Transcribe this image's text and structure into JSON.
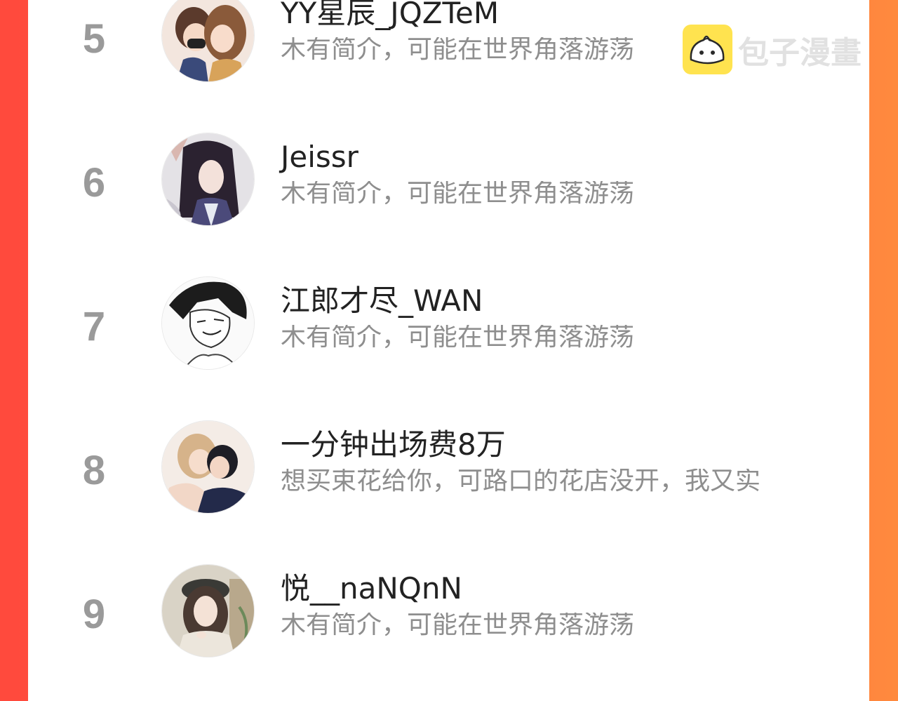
{
  "ranking": {
    "rows": [
      {
        "rank": "5",
        "name": "YY星辰_JQZTeM",
        "bio": "木有简介，可能在世界角落游荡"
      },
      {
        "rank": "6",
        "name": "Jeissr",
        "bio": "木有简介，可能在世界角落游荡"
      },
      {
        "rank": "7",
        "name": "江郎才尽_WAN",
        "bio": "木有简介，可能在世界角落游荡"
      },
      {
        "rank": "8",
        "name": "一分钟出场费8万",
        "bio": "想买束花给你，可路口的花店没开，我又实"
      },
      {
        "rank": "9",
        "name": "悦__naNQnN",
        "bio": "木有简介，可能在世界角落游荡"
      }
    ]
  },
  "watermark": {
    "text": "包子漫畫",
    "icon": "baozi-logo-icon"
  },
  "colors": {
    "background_left": "#ff4a3d",
    "background_right": "#ff8a3e",
    "rank": "#9a9a9a",
    "name": "#222222",
    "bio": "#8e8e8e",
    "logo_yellow": "#ffe34f"
  }
}
